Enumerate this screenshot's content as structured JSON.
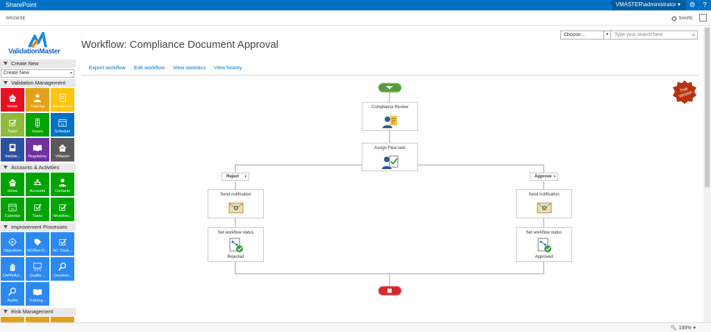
{
  "topbar": {
    "brand": "SharePoint",
    "user": "VMASTER\\administrator ▾",
    "settings_icon": "gear-icon",
    "help_icon": "question-icon"
  },
  "ribbon": {
    "browse": "BROWSE",
    "share": "SHARE"
  },
  "sidebar": {
    "logo_text": "ValidationMaster",
    "create_new": {
      "header": "Create New",
      "combo_value": "Create New"
    },
    "validation_management": {
      "header": "Validation Management",
      "tiles": [
        {
          "label": "Home",
          "color": "#e81123",
          "icon": "home-icon"
        },
        {
          "label": "Training",
          "color": "#e3a21a",
          "icon": "person-icon"
        },
        {
          "label": "Documents",
          "color": "#ffc40d",
          "icon": "document-icon"
        },
        {
          "label": "Tasks",
          "color": "#8fba3b",
          "icon": "checkbox-icon"
        },
        {
          "label": "Issues",
          "color": "#00a300",
          "icon": "traffic-light-icon"
        },
        {
          "label": "Schedule",
          "color": "#0072c6",
          "icon": "calendar-icon"
        },
        {
          "label": "Validati...",
          "color": "#2d4f9e",
          "icon": "book-icon"
        },
        {
          "label": "Regulatory",
          "color": "#7030a0",
          "icon": "open-book-icon"
        },
        {
          "label": "VMaster",
          "color": "#5a5a5a",
          "icon": "home-icon"
        }
      ]
    },
    "accounts_activities": {
      "header": "Accounts & Activities",
      "tiles": [
        {
          "label": "Home",
          "color": "#00a300",
          "icon": "home-icon"
        },
        {
          "label": "Accounts",
          "color": "#00a300",
          "icon": "desk-icon"
        },
        {
          "label": "Contacts",
          "color": "#00a300",
          "icon": "person-icon"
        },
        {
          "label": "Calendar",
          "color": "#00a300",
          "icon": "calendar-icon"
        },
        {
          "label": "Tasks",
          "color": "#00a300",
          "icon": "checkbox-icon"
        },
        {
          "label": "Workflow...",
          "color": "#00a300",
          "icon": "checkbox-icon"
        }
      ]
    },
    "improvement_processes": {
      "header": "Improvement Processes",
      "tiles": [
        {
          "label": "Objectives",
          "color": "#2d89ef",
          "icon": "target-icon"
        },
        {
          "label": "NC/Non-C...",
          "color": "#2d89ef",
          "icon": "tag-icon"
        },
        {
          "label": "NC Track...",
          "color": "#2d89ef",
          "icon": "checkbox-icon"
        },
        {
          "label": "CAPA/Act...",
          "color": "#2d89ef",
          "icon": "hand-icon"
        },
        {
          "label": "Quality ...",
          "color": "#2d89ef",
          "icon": "easel-icon"
        },
        {
          "label": "Question...",
          "color": "#2d89ef",
          "icon": "magnifier-icon"
        },
        {
          "label": "Audits",
          "color": "#2d89ef",
          "icon": "magnifier-icon"
        },
        {
          "label": "Training...",
          "color": "#2d89ef",
          "icon": "open-book-icon"
        }
      ]
    },
    "risk_management": {
      "header": "Risk Management"
    }
  },
  "main": {
    "breadcrumb": ".",
    "title": "Workflow: Compliance Document Approval",
    "links": [
      "Export workflow",
      "Edit workflow",
      "View statistics",
      "View history"
    ],
    "search": {
      "scope": "Choose...",
      "placeholder": "Type your search here"
    },
    "trial_badge": "Trial Version"
  },
  "workflow": {
    "compliance_review": "Compliance Review",
    "assign_flexi": "Assign Flexi task",
    "reject_label": "Reject",
    "approve_label": "Approve",
    "send_notification_left": "Send notification",
    "send_notification_right": "Send notification",
    "set_status_left": "Set workflow status",
    "set_status_right": "Set workflow status",
    "status_rejected": "Rejected",
    "status_approved": "Approved"
  },
  "statusbar": {
    "zoom": "100%"
  }
}
